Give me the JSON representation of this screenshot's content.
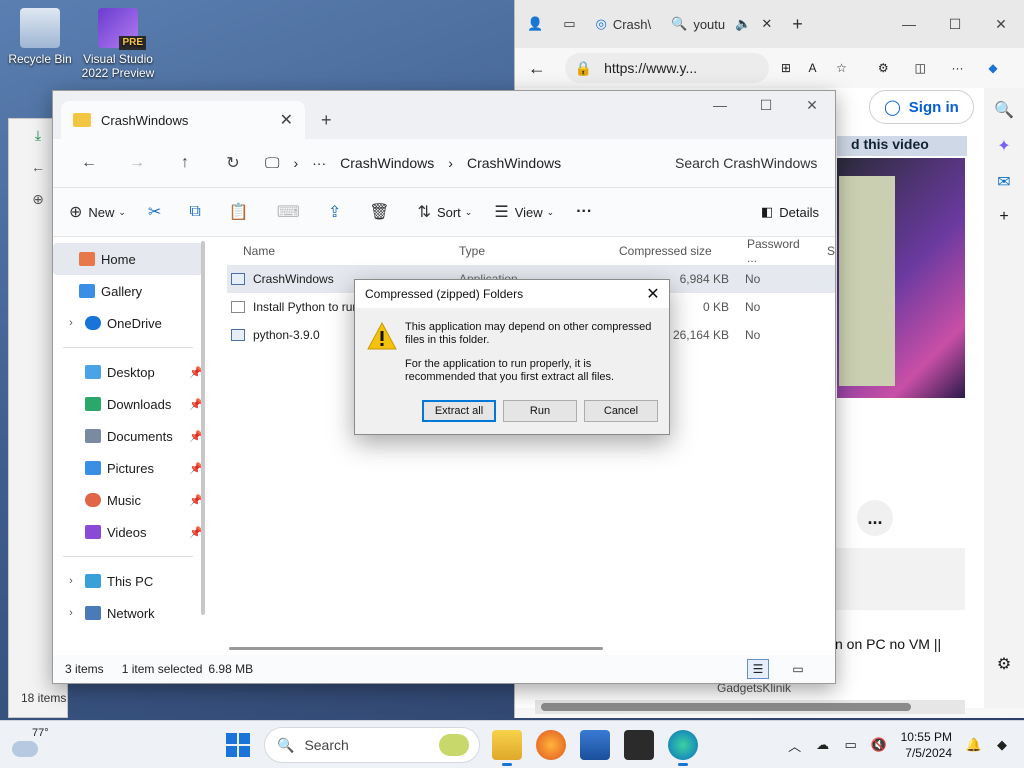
{
  "desktop": {
    "icons": [
      {
        "label": "Recycle Bin"
      },
      {
        "label": "Visual Studio 2022 Preview",
        "badge": "PRE"
      }
    ],
    "bg_explorer_items_count": "18 items"
  },
  "browser": {
    "tabs": [
      {
        "label": "Crash\\"
      },
      {
        "label": "youtu"
      }
    ],
    "url": "https://www.y...",
    "sign_in": "Sign in",
    "video_banner": "d this video",
    "more_label": "...",
    "video_title": "n on PC no VM ||",
    "channel": "GadgetsKlinik"
  },
  "explorer": {
    "tab_title": "CrashWindows",
    "breadcrumb": [
      "CrashWindows",
      "CrashWindows"
    ],
    "search_placeholder": "Search CrashWindows",
    "toolbar": {
      "new": "New",
      "sort": "Sort",
      "view": "View",
      "details": "Details"
    },
    "nav": {
      "home": "Home",
      "gallery": "Gallery",
      "onedrive": "OneDrive",
      "desktop": "Desktop",
      "downloads": "Downloads",
      "documents": "Documents",
      "pictures": "Pictures",
      "music": "Music",
      "videos": "Videos",
      "this_pc": "This PC",
      "network": "Network"
    },
    "columns": {
      "name": "Name",
      "type": "Type",
      "compressed_size": "Compressed size",
      "password": "Password ...",
      "size": "Si"
    },
    "files": [
      {
        "name": "CrashWindows",
        "type": "Application",
        "size": "6,984 KB",
        "password": "No"
      },
      {
        "name": "Install Python to run",
        "type": "",
        "size": "0 KB",
        "password": "No"
      },
      {
        "name": "python-3.9.0",
        "type": "",
        "size": "26,164 KB",
        "password": "No"
      }
    ],
    "status": {
      "items": "3 items",
      "selected": "1 item selected",
      "selected_size": "6.98 MB"
    }
  },
  "dialog": {
    "title": "Compressed (zipped) Folders",
    "line1": "This application may depend on other compressed files in this folder.",
    "line2": "For the application to run properly, it is recommended that you first extract all files.",
    "buttons": {
      "extract": "Extract all",
      "run": "Run",
      "cancel": "Cancel"
    }
  },
  "taskbar": {
    "temp": "77°",
    "search": "Search",
    "time": "10:55 PM",
    "date": "7/5/2024"
  }
}
